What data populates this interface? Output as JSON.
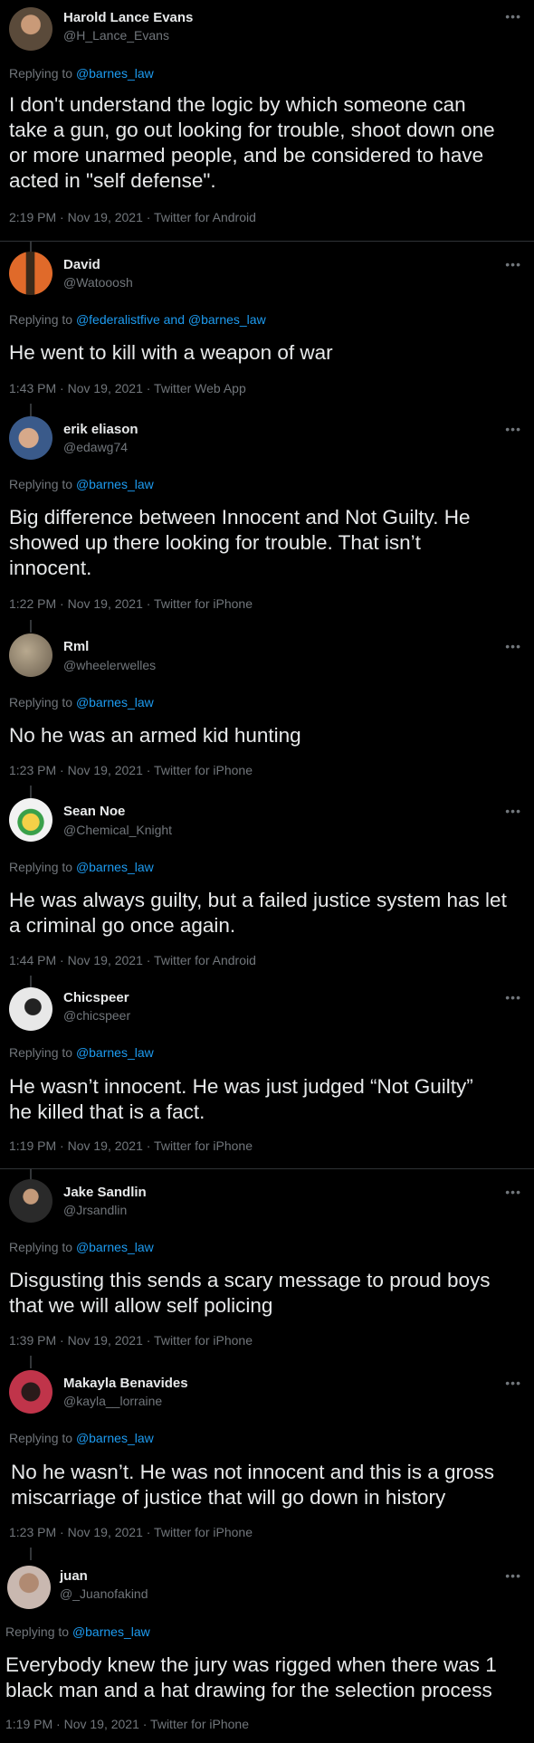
{
  "colors": {
    "background": "#000000",
    "text": "#e7e9ea",
    "muted": "#71767b",
    "link": "#1d9bf0",
    "divider": "#2f3336"
  },
  "more_icon": "more-horizontal-icon",
  "tweets": [
    {
      "name": "Harold Lance Evans",
      "handle": "@H_Lance_Evans",
      "replying_prefix": "Replying to ",
      "replying_to": "@barnes_law",
      "text": "I don't understand the logic by which someone can\ntake a gun, go out looking for trouble, shoot down one\nor more unarmed people, and be considered to have\nacted in \"self defense\".",
      "meta": "2:19 PM · Nov 19, 2021 · Twitter for Android",
      "avatar_color": "#5a4a3a"
    },
    {
      "name": "David",
      "handle": "@Watooosh",
      "replying_prefix": "Replying to ",
      "replying_to": "@federalistfive and @barnes_law",
      "text": "He went to kill with a weapon of war",
      "meta": "1:43 PM · Nov 19, 2021 · Twitter Web App",
      "avatar_color": "#e06a2a"
    },
    {
      "name": "erik eliason",
      "handle": "@edawg74",
      "replying_prefix": "Replying to ",
      "replying_to": "@barnes_law",
      "text": "Big difference between Innocent and Not Guilty.  He\nshowed up there looking for trouble.  That isn’t\ninnocent.",
      "meta": "1:22 PM · Nov 19, 2021 · Twitter for iPhone",
      "avatar_color": "#3a5a8a"
    },
    {
      "name": "Rml",
      "handle": "@wheelerwelles",
      "replying_prefix": "Replying to ",
      "replying_to": "@barnes_law",
      "text": "No he was an armed kid hunting",
      "meta": "1:23 PM · Nov 19, 2021 · Twitter for iPhone",
      "avatar_color": "#8a7a66"
    },
    {
      "name": "Sean Noe",
      "handle": "@Chemical_Knight",
      "replying_prefix": "Replying to ",
      "replying_to": "@barnes_law",
      "text": "He was always guilty, but a failed justice system has let\na criminal go once again.",
      "meta": "1:44 PM · Nov 19, 2021 · Twitter for Android",
      "avatar_color": "#f2f2f2"
    },
    {
      "name": "Chicspeer",
      "handle": "@chicspeer",
      "replying_prefix": "Replying to ",
      "replying_to": "@barnes_law",
      "text": "He wasn’t innocent. He was just judged “Not Guilty”\nhe killed that is a fact.",
      "meta": "1:19 PM · Nov 19, 2021 · Twitter for iPhone",
      "avatar_color": "#e8e8e8"
    },
    {
      "name": "Jake Sandlin",
      "handle": "@Jrsandlin",
      "replying_prefix": "Replying to ",
      "replying_to": "@barnes_law",
      "text": "Disgusting this sends a scary message to proud boys\nthat we will allow self policing",
      "meta": "1:39 PM · Nov 19, 2021 · Twitter for iPhone",
      "avatar_color": "#2a2a2a"
    },
    {
      "name": "Makayla Benavides",
      "handle": "@kayla__lorraine",
      "replying_prefix": "Replying to ",
      "replying_to": "@barnes_law",
      "text": "No he wasn’t. He was not innocent and this is a gross\nmiscarriage of justice that will go down in history",
      "meta": "1:23 PM · Nov 19, 2021 · Twitter for iPhone",
      "avatar_color": "#c0344a"
    },
    {
      "name": "juan",
      "handle": "@_Juanofakind",
      "replying_prefix": "Replying to ",
      "replying_to": "@barnes_law",
      "text": "Everybody knew the jury was rigged when there was 1\nblack man and a hat drawing for the selection process",
      "meta": "1:19 PM · Nov 19, 2021 · Twitter for iPhone",
      "avatar_color": "#c9b8b0"
    }
  ]
}
